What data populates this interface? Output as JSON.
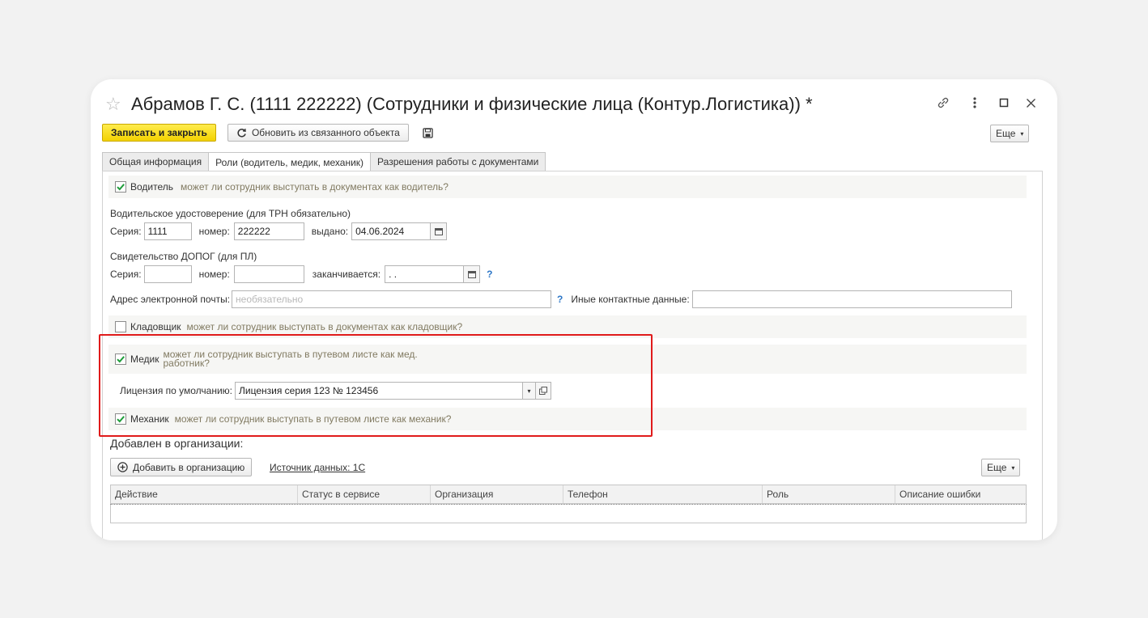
{
  "window": {
    "title": "Абрамов Г. С. (1111 222222) (Сотрудники и физические лица (Контур.Логистика)) *"
  },
  "toolbar": {
    "save_close": "Записать и закрыть",
    "refresh": "Обновить из связанного объекта",
    "more": "Еще"
  },
  "tabs": [
    {
      "label": "Общая информация"
    },
    {
      "label": "Роли (водитель, медик, механик)"
    },
    {
      "label": "Разрешения работы с документами"
    }
  ],
  "driver": {
    "label": "Водитель",
    "hint": "может ли сотрудник выступать в документах как водитель?",
    "checked": true
  },
  "license": {
    "title": "Водительское удостоверение (для ТРН обязательно)",
    "series_label": "Серия:",
    "series": "1111",
    "number_label": "номер:",
    "number": "222222",
    "issued_label": "выдано:",
    "issued": "04.06.2024"
  },
  "adr": {
    "title": "Свидетельство ДОПОГ (для ПЛ)",
    "series_label": "Серия:",
    "series": "",
    "number_label": "номер:",
    "number": "",
    "expires_label": "заканчивается:",
    "expires": " .  ."
  },
  "contacts": {
    "email_label": "Адрес электронной почты:",
    "email_placeholder": "необязательно",
    "other_label": "Иные контактные данные:",
    "other": "",
    "help": "?"
  },
  "storekeeper": {
    "label": "Кладовщик",
    "hint": "может ли сотрудник выступать в документах как кладовщик?",
    "checked": false
  },
  "medic": {
    "label": "Медик",
    "hint_line1": "может ли сотрудник выступать в путевом листе как мед.",
    "hint_line2": "работник?",
    "checked": true,
    "default_license_label": "Лицензия по умолчанию:",
    "default_license": "Лицензия серия 123 № 123456"
  },
  "mechanic": {
    "label": "Механик",
    "hint": "может ли сотрудник выступать в путевом листе как механик?",
    "checked": true
  },
  "organizations": {
    "title": "Добавлен в организации:",
    "add_button": "Добавить в организацию",
    "source_link": "Источник данных: 1С",
    "more": "Еще",
    "columns": [
      "Действие",
      "Статус в сервисе",
      "Организация",
      "Телефон",
      "Роль",
      "Описание ошибки"
    ]
  },
  "colors": {
    "accent_yellow": "#f3d200",
    "highlight_red": "#e01b1b",
    "check_green": "#1f9d3a",
    "hint_text": "#817a61",
    "help_blue": "#2d77c7"
  }
}
